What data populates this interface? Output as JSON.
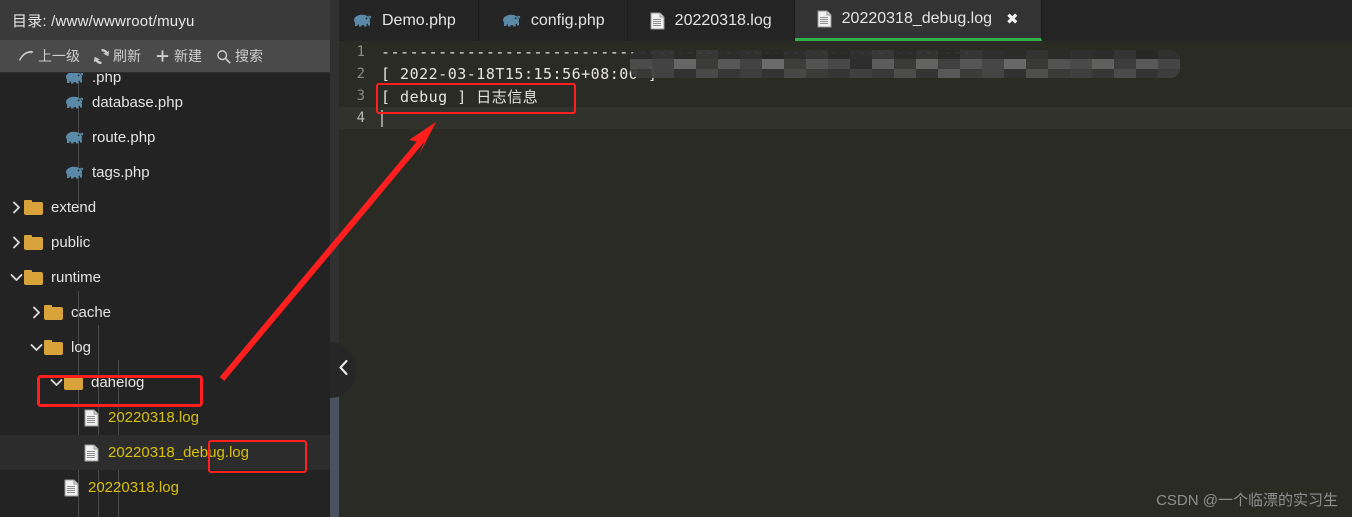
{
  "header": {
    "label": "目录: /www/wwwroot/muyu"
  },
  "toolbar": {
    "buttons": [
      {
        "label": "上一级",
        "icon": "up-arrow-icon"
      },
      {
        "label": "刷新",
        "icon": "refresh-icon"
      },
      {
        "label": "新建",
        "icon": "plus-icon"
      },
      {
        "label": "搜索",
        "icon": "search-icon"
      }
    ]
  },
  "tree": {
    "items": [
      {
        "name": ".php",
        "type": "php",
        "indent": 3,
        "clipped": true,
        "expanded": null,
        "selected": false
      },
      {
        "name": "database.php",
        "type": "php",
        "indent": 3,
        "expanded": null,
        "selected": false
      },
      {
        "name": "route.php",
        "type": "php",
        "indent": 3,
        "expanded": null,
        "selected": false
      },
      {
        "name": "tags.php",
        "type": "php",
        "indent": 3,
        "expanded": null,
        "selected": false
      },
      {
        "name": "extend",
        "type": "folder",
        "indent": 1,
        "expanded": false,
        "selected": false
      },
      {
        "name": "public",
        "type": "folder",
        "indent": 1,
        "expanded": false,
        "selected": false
      },
      {
        "name": "runtime",
        "type": "folder",
        "indent": 1,
        "expanded": true,
        "selected": false
      },
      {
        "name": "cache",
        "type": "folder",
        "indent": 2,
        "expanded": false,
        "selected": false
      },
      {
        "name": "log",
        "type": "folder",
        "indent": 2,
        "expanded": true,
        "selected": false
      },
      {
        "name": "dahelog",
        "type": "folder",
        "indent": 3,
        "expanded": true,
        "selected": false,
        "highlight": "box"
      },
      {
        "name": "20220318.log",
        "type": "log",
        "indent": 4,
        "expanded": null,
        "selected": false
      },
      {
        "name": "20220318_debug.log",
        "type": "log",
        "indent": 4,
        "expanded": null,
        "selected": true,
        "highlight": "partial-box"
      },
      {
        "name": "20220318.log",
        "type": "log",
        "indent": 3,
        "expanded": null,
        "selected": false
      }
    ]
  },
  "tabs": [
    {
      "label": "Demo.php",
      "icon": "php-icon",
      "active": false,
      "closable": false
    },
    {
      "label": "config.php",
      "icon": "php-icon",
      "active": false,
      "closable": false
    },
    {
      "label": "20220318.log",
      "icon": "document-icon",
      "active": false,
      "closable": false
    },
    {
      "label": "20220318_debug.log",
      "icon": "document-icon",
      "active": true,
      "closable": true,
      "close_label": "✖"
    }
  ],
  "editor": {
    "lines": [
      {
        "no": "1",
        "text": "--------------------------------------------------------------",
        "current": false
      },
      {
        "no": "2",
        "text": "[ 2022-03-18T15:15:56+08:00 ]",
        "current": false,
        "masked": true
      },
      {
        "no": "3",
        "text": "[ debug ] 日志信息",
        "current": false,
        "highlight": "box"
      },
      {
        "no": "4",
        "text": "",
        "current": true,
        "caret": true
      }
    ]
  },
  "collapse_handle": {
    "icon": "chevron-left-icon"
  },
  "annotation": {
    "arrow_color": "#ff1f1f",
    "box_color": "#ff1f1f"
  },
  "watermark": {
    "text": "CSDN @一个临漂的实习生"
  },
  "colors": {
    "accent_green": "#2fb24c",
    "log_yellow": "#d9c00a",
    "folder_gold": "#d8a33a",
    "php_blue": "#5b8aa8",
    "tree_bg": "#232323",
    "editor_bg": "#2b2b26"
  }
}
